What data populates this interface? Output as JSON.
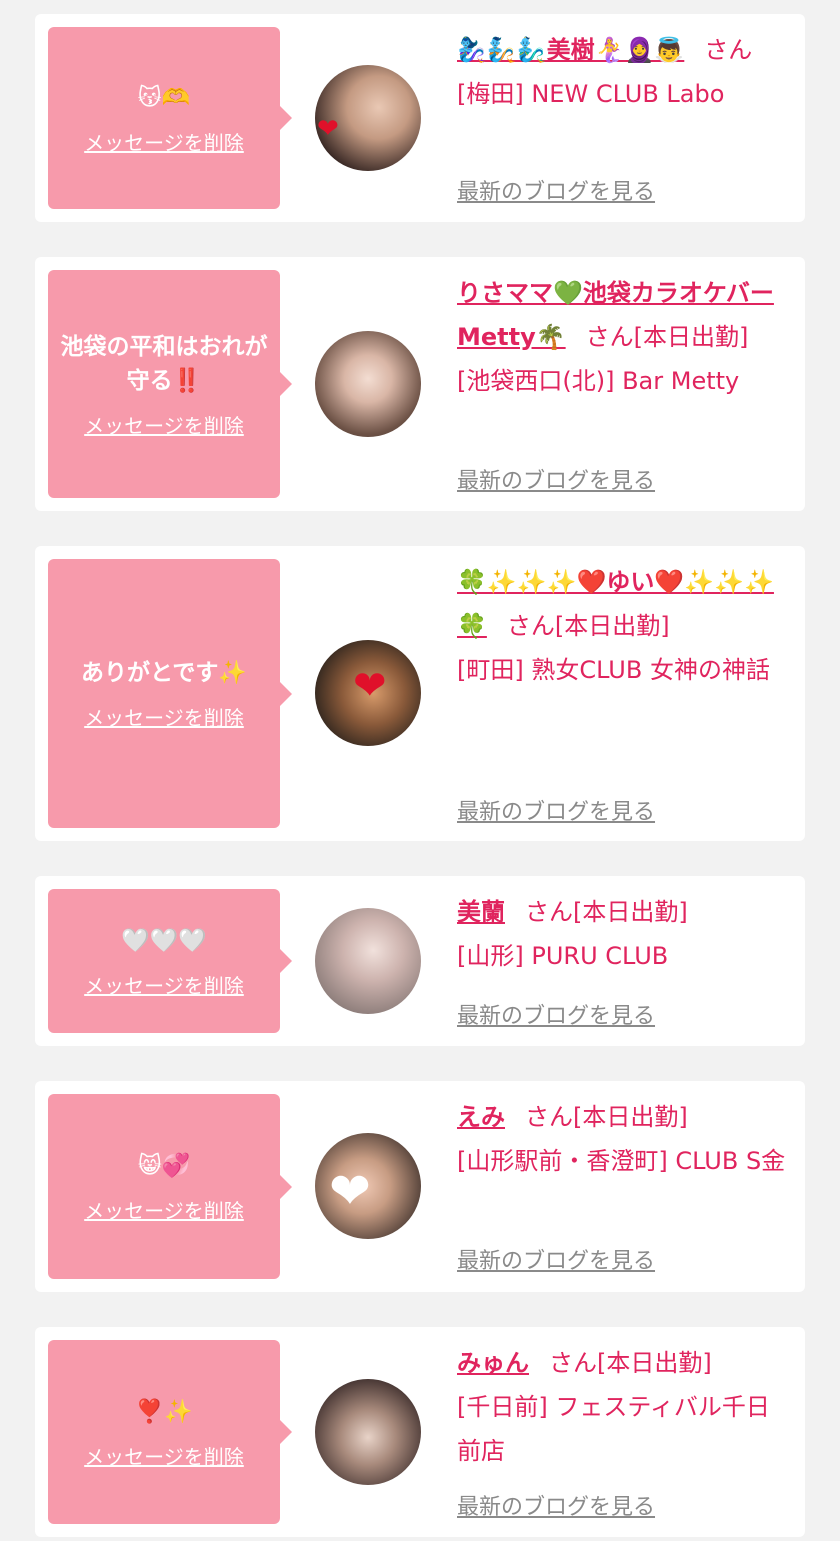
{
  "cards": [
    {
      "message": "😽🫶",
      "delete_label": "メッセージを削除",
      "name": "🧞‍♀️🧞🧞‍♂️美樹🧜‍♀️🧕👼",
      "san": "さん",
      "status": "",
      "shop": "[梅田] NEW CLUB Labo",
      "blog_label": "最新のブログを見る"
    },
    {
      "message": "池袋の平和はおれが守る‼️",
      "delete_label": "メッセージを削除",
      "name": "りさママ💚池袋カラオケバーMetty🌴",
      "san": "さん",
      "status": "[本日出勤]",
      "shop": "[池袋西口(北)] Bar Metty",
      "blog_label": "最新のブログを見る"
    },
    {
      "message": "ありがとです✨",
      "delete_label": "メッセージを削除",
      "name": "🍀✨✨✨❤️ゆい❤️✨✨✨🍀",
      "san": "さん",
      "status": "[本日出勤]",
      "shop": "[町田] 熟女CLUB 女神の神話",
      "blog_label": "最新のブログを見る"
    },
    {
      "message": "🤍🤍🤍",
      "delete_label": "メッセージを削除",
      "name": "美蘭",
      "san": "さん",
      "status": "[本日出勤]",
      "shop": "[山形] PURU CLUB",
      "blog_label": "最新のブログを見る"
    },
    {
      "message": "😸💞",
      "delete_label": "メッセージを削除",
      "name": "えみ",
      "san": "さん",
      "status": "[本日出勤]",
      "shop": "[山形駅前・香澄町] CLUB S金",
      "blog_label": "最新のブログを見る"
    },
    {
      "message": "❣️✨",
      "delete_label": "メッセージを削除",
      "name": "みゅん",
      "san": "さん",
      "status": "[本日出勤]",
      "shop": "[千日前] フェスティバル千日前店",
      "blog_label": "最新のブログを見る"
    }
  ],
  "colors": {
    "page_bg": "#f2f2f2",
    "bubble_bg": "#f79aab",
    "accent_text": "#e0245e",
    "link_gray": "#8a8a8a"
  }
}
